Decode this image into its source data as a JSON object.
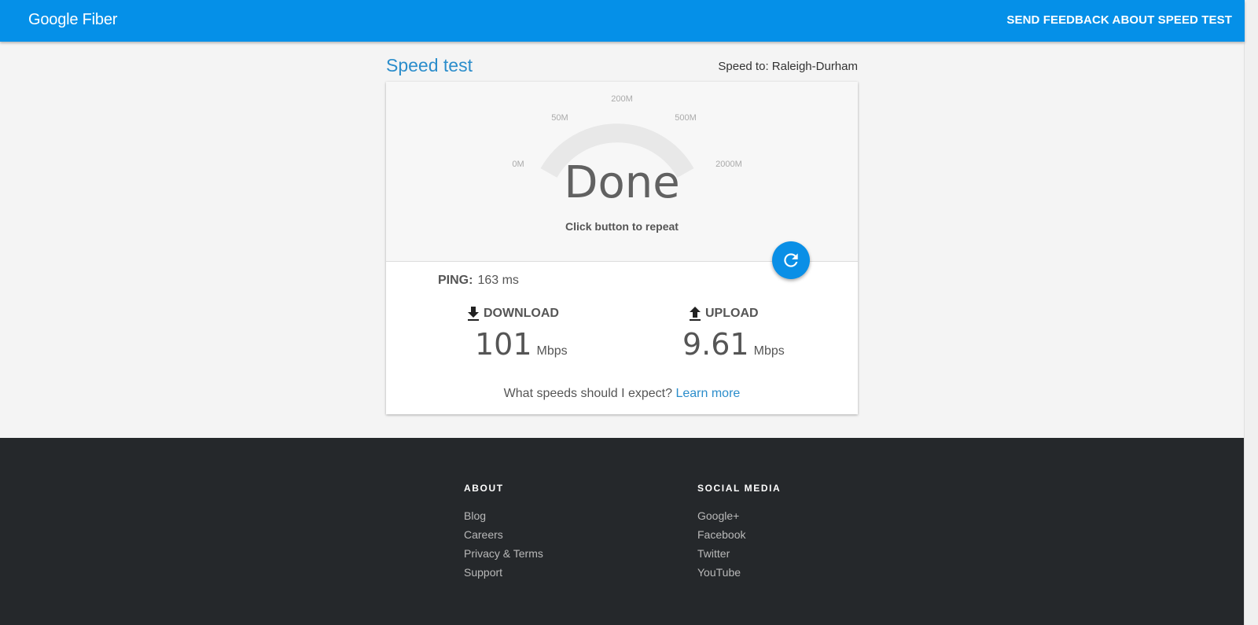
{
  "header": {
    "logo": "Google Fiber",
    "feedback_label": "SEND FEEDBACK ABOUT SPEED TEST"
  },
  "page": {
    "title": "Speed test",
    "speed_to": "Speed to: Raleigh-Durham"
  },
  "gauge": {
    "ticks": [
      "0M",
      "50M",
      "200M",
      "500M",
      "2000M"
    ],
    "status": "Done",
    "hint": "Click button to repeat",
    "repeat_icon": "refresh-icon"
  },
  "results": {
    "ping_label": "PING:",
    "ping_value": "163 ms",
    "download": {
      "label": "DOWNLOAD",
      "value": "101",
      "unit": "Mbps",
      "icon": "download-icon"
    },
    "upload": {
      "label": "UPLOAD",
      "value": "9.61",
      "unit": "Mbps",
      "icon": "upload-icon"
    },
    "expect_text": "What speeds should I expect?",
    "learn_more": "Learn more"
  },
  "footer": {
    "about": {
      "heading": "ABOUT",
      "links": [
        "Blog",
        "Careers",
        "Privacy & Terms",
        "Support"
      ]
    },
    "social": {
      "heading": "SOCIAL MEDIA",
      "links": [
        "Google+",
        "Facebook",
        "Twitter",
        "YouTube"
      ]
    }
  },
  "colors": {
    "brand_blue": "#0590e8",
    "link_blue": "#2b8dcb",
    "footer_bg": "#25282b",
    "gauge_track": "#e8e8e8"
  }
}
